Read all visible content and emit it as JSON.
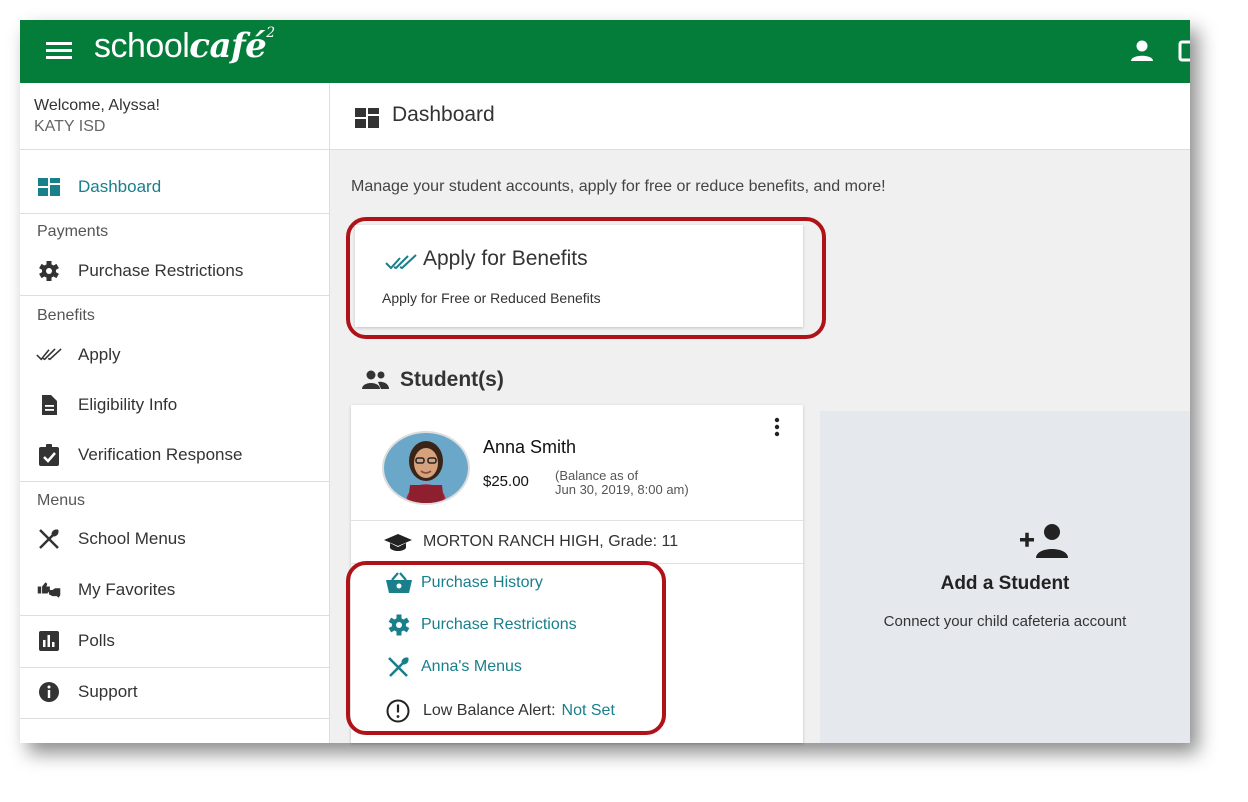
{
  "header": {
    "brand_plain": "school",
    "brand_styled": "café",
    "brand_mark": "2",
    "icons": [
      "menu-icon",
      "user-icon",
      "tablet-icon"
    ]
  },
  "sidebar": {
    "welcome": "Welcome, Alyssa!",
    "district": "KATY ISD",
    "sections": {
      "payments": "Payments",
      "benefits": "Benefits",
      "menus": "Menus"
    },
    "items": {
      "dashboard": "Dashboard",
      "purchase_restrictions": "Purchase Restrictions",
      "apply": "Apply",
      "eligibility_info": "Eligibility Info",
      "verification_response": "Verification Response",
      "school_menus": "School Menus",
      "my_favorites": "My Favorites",
      "polls": "Polls",
      "support": "Support"
    }
  },
  "main": {
    "title": "Dashboard",
    "intro": "Manage your student accounts, apply for free or reduce benefits, and more!",
    "benefits_card": {
      "title": "Apply for Benefits",
      "subtitle": "Apply for Free or Reduced Benefits"
    },
    "students_heading": "Student(s)",
    "student": {
      "name": "Anna Smith",
      "balance": "$25.00",
      "balance_note_line1": "(Balance as of",
      "balance_note_line2": "Jun 30, 2019, 8:00 am)",
      "school": "MORTON RANCH HIGH, Grade: 11",
      "links": {
        "purchase_history": "Purchase History",
        "purchase_restrictions": "Purchase Restrictions",
        "menus": "Anna's Menus"
      },
      "low_balance_label": "Low Balance Alert:",
      "low_balance_value": "Not Set"
    },
    "add_student": {
      "title": "Add a Student",
      "subtitle": "Connect your child cafeteria account"
    }
  },
  "colors": {
    "brand_green": "#047d3b",
    "teal": "#187f8b",
    "highlight_red": "#b01219"
  }
}
